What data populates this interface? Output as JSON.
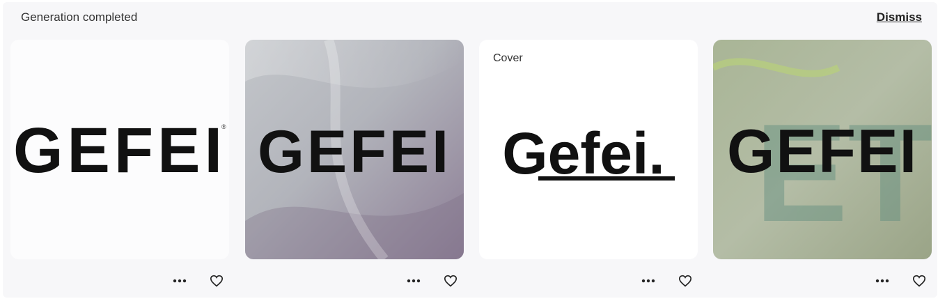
{
  "header": {
    "title": "Generation completed",
    "dismiss_label": "Dismiss"
  },
  "cards": [
    {
      "logo_text": "GEFEI",
      "badge": "",
      "bg": "#ffffff",
      "text_color": "#111111"
    },
    {
      "logo_text": "GEFEI",
      "badge": "",
      "bg": "#a9a7b4",
      "text_color": "#111111"
    },
    {
      "logo_text": "Gefei.",
      "badge": "Cover",
      "bg": "#ffffff",
      "text_color": "#111111"
    },
    {
      "logo_text": "GEFEI",
      "badge": "",
      "bg": "#9fae8f",
      "text_color": "#111111"
    }
  ],
  "icons": {
    "more": "more-horizontal-icon",
    "like": "heart-outline-icon"
  }
}
